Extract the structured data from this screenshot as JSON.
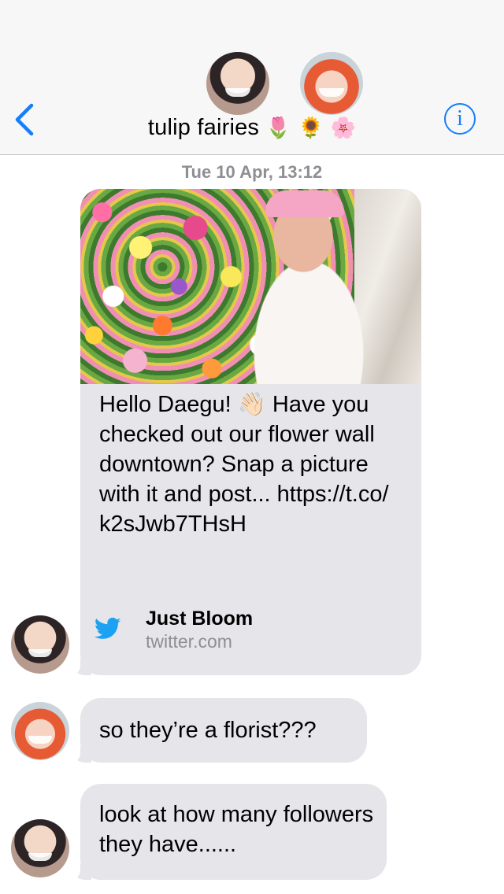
{
  "header": {
    "title": "tulip fairies",
    "title_emoji": "🌷 🌻 🌸",
    "back_icon": "chevron-left-icon",
    "info_icon": "info-icon",
    "info_glyph": "i",
    "accent_color": "#147efb"
  },
  "conversation": {
    "timestamp": "Tue 10 Apr, 13:12",
    "link_message": {
      "text_before_emoji": "Hello Daegu!",
      "emoji": "👋🏻",
      "text_after_emoji": "Have you checked out our flower wall downtown? Snap a picture with it and post... https://t.co/ k2sJwb7THsH",
      "source_name": "Just Bloom",
      "source_domain": "twitter.com",
      "source_icon": "twitter-bird-icon"
    },
    "messages": [
      {
        "text": "so they’re a florist???"
      },
      {
        "text": "look at how many followers they have......"
      }
    ]
  },
  "colors": {
    "bubble_gray": "#e5e5ea",
    "header_bg": "#f7f7f7",
    "timestamp_gray": "#8e8e93",
    "twitter_blue": "#1da1f2"
  }
}
